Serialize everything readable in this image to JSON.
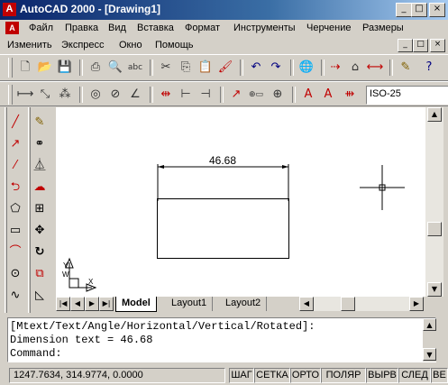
{
  "window": {
    "title": "AutoCAD 2000 - [Drawing1]",
    "app_icon": "A",
    "min_glyph": "_",
    "max_glyph": "□",
    "close_glyph": "×"
  },
  "menubar1": [
    "Файл",
    "Правка",
    "Вид",
    "Вставка",
    "Формат",
    "Инструменты",
    "Черчение",
    "Размеры"
  ],
  "menubar2": [
    "Изменить",
    "Экспресс",
    "Окно",
    "Помощь"
  ],
  "standard_toolbar": {
    "icons": [
      "new-icon",
      "open-icon",
      "save-icon",
      "print-icon",
      "preview-icon",
      "spell-icon",
      "cut-icon",
      "copy-icon",
      "paste-icon",
      "match-properties-icon",
      "undo-icon",
      "redo-icon",
      "internet-icon",
      "ucs-icon",
      "named-views-icon",
      "distance-icon",
      "pencil-icon",
      "help-icon"
    ]
  },
  "dimension_toolbar": {
    "style_value": "ISO-25"
  },
  "canvas": {
    "dimension_text": "46.68",
    "ucs_labels": {
      "y": "Y",
      "w": "W",
      "x": "X"
    }
  },
  "tabs": [
    {
      "label": "Model",
      "active": true
    },
    {
      "label": "Layout1",
      "active": false
    },
    {
      "label": "Layout2",
      "active": false
    }
  ],
  "command_window": {
    "lines": [
      "[Mtext/Text/Angle/Horizontal/Vertical/Rotated]:",
      "Dimension text = 46.68",
      "Command:"
    ]
  },
  "statusbar": {
    "coordinates": "1247.7634, 314.9774, 0.0000",
    "toggles": [
      "ШАГ",
      "СЕТКА",
      "ОРТО",
      "ПОЛЯР",
      "ВЫРВ",
      "СЛЕД",
      "ВЕ"
    ]
  },
  "colors": {
    "title_start": "#0a246a",
    "title_end": "#a6caf0",
    "chrome": "#d4d0c8",
    "canvas": "#ffffff"
  }
}
